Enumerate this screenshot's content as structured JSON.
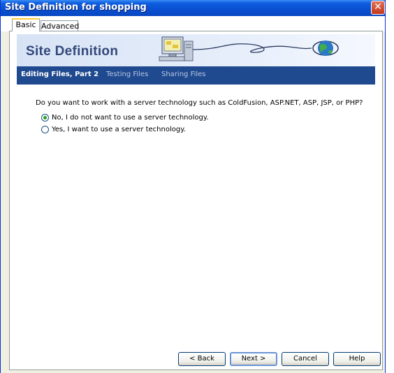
{
  "window": {
    "title": "Site Definition for shopping",
    "close_glyph": "✕"
  },
  "tabs": [
    {
      "label": "Basic",
      "active": true
    },
    {
      "label": "Advanced",
      "active": false
    }
  ],
  "banner": {
    "title": "Site Definition"
  },
  "steps": [
    {
      "label": "Editing Files, Part 2",
      "active": true
    },
    {
      "label": "Testing Files",
      "active": false
    },
    {
      "label": "Sharing Files",
      "active": false
    }
  ],
  "question": "Do you want to work with a server technology such as ColdFusion, ASP.NET, ASP, JSP, or PHP?",
  "options": [
    {
      "label": "No, I do not want to use a server technology.",
      "selected": true
    },
    {
      "label": "Yes, I want to use a server technology.",
      "selected": false
    }
  ],
  "buttons": {
    "back": "< Back",
    "next": "Next >",
    "cancel": "Cancel",
    "help": "Help"
  },
  "colors": {
    "titlebar": "#0a4fd0",
    "stepbar": "#1f4a8f",
    "banner_title": "#33487a",
    "radio_selected": "#21a121"
  }
}
